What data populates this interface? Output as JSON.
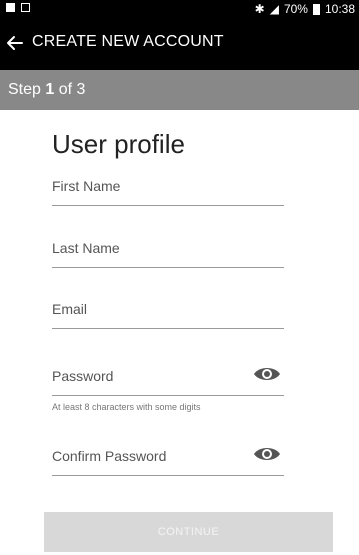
{
  "status_bar": {
    "battery": "70%",
    "time": "10:38"
  },
  "app_bar": {
    "title": "CREATE NEW ACCOUNT"
  },
  "step": {
    "prefix": "Step ",
    "current": "1",
    "suffix": " of 3"
  },
  "form": {
    "title": "User profile",
    "first_name_placeholder": "First Name",
    "last_name_placeholder": "Last Name",
    "email_placeholder": "Email",
    "password_placeholder": "Password",
    "password_hint": "At least 8 characters with some digits",
    "confirm_password_placeholder": "Confirm Password",
    "continue_label": "CONTINUE"
  }
}
